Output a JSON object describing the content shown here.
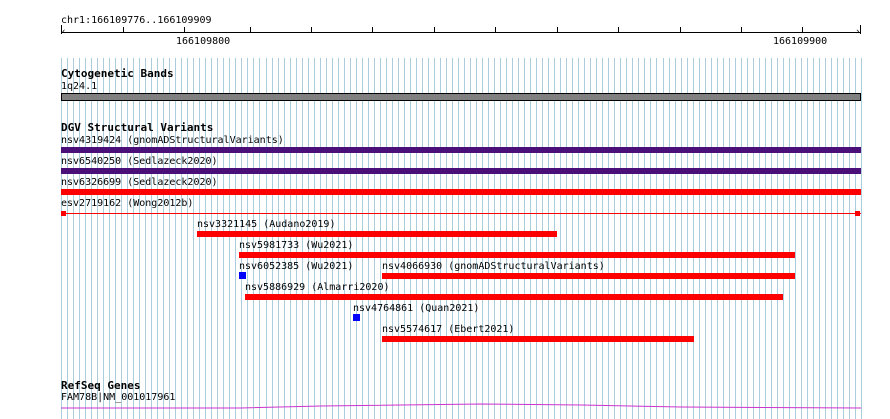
{
  "region": {
    "label": "chr1:166109776..166109909",
    "start": 166109776,
    "end": 166109909
  },
  "ruler": {
    "ticks": [
      {
        "label": "166109800"
      },
      {
        "label": "166109900"
      }
    ]
  },
  "cytobands": {
    "title": "Cytogenetic Bands",
    "band_label": "1q24.1"
  },
  "dgv": {
    "title": "DGV Structural Variants",
    "features": [
      {
        "label": "nsv4319424 (gnomADStructuralVariants)",
        "color": "#4b0f7a"
      },
      {
        "label": "nsv6540250 (Sedlazeck2020)",
        "color": "#4b0f7a"
      },
      {
        "label": "nsv6326699 (Sedlazeck2020)",
        "color": "#ff0000"
      },
      {
        "label": "esv2719162 (Wong2012b)",
        "color": "#ff0000"
      },
      {
        "label": "nsv3321145 (Audano2019)",
        "color": "#ff0000"
      },
      {
        "label": "nsv5981733 (Wu2021)",
        "color": "#ff0000"
      },
      {
        "label": "nsv6052385 (Wu2021)",
        "color": "#0000ff"
      },
      {
        "label": "nsv4066930 (gnomADStructuralVariants)",
        "color": "#ff0000"
      },
      {
        "label": "nsv5886929 (Almarri2020)",
        "color": "#ff0000"
      },
      {
        "label": "nsv4764861 (Quan2021)",
        "color": "#0000ff"
      },
      {
        "label": "nsv5574617 (Ebert2021)",
        "color": "#ff0000"
      }
    ]
  },
  "refseq": {
    "title": "RefSeq Genes",
    "gene_label": "FAM78B|NM_001017961",
    "color": "#cc33cc"
  },
  "colors": {
    "grid": "#aaccdd",
    "band": "#808080"
  }
}
